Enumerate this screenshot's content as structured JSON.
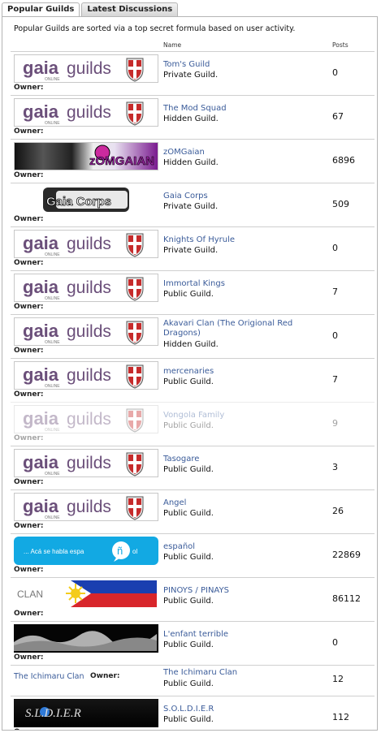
{
  "tabs": [
    {
      "label": "Popular Guilds",
      "active": true
    },
    {
      "label": "Latest Discussions",
      "active": false
    }
  ],
  "intro": "Popular Guilds are sorted via a top secret formula based on user activity.",
  "columns": {
    "name": "Name",
    "posts": "Posts"
  },
  "owner_label": "Owner:",
  "banner_text": {
    "gaia": "gaia",
    "online": "ONLINE",
    "guilds": "guilds",
    "zomg": "zOMGAIAN",
    "gaiacorps": "Gaia Corps",
    "espanol": "... Acá se habla espa",
    "espanol_n": "ñ",
    "espanol_tail": "ol",
    "clan": "CLAN",
    "soldier": "S.L.D.I.E.R"
  },
  "guilds": [
    {
      "name": "Tom's Guild",
      "type": "Private Guild.",
      "posts": "0",
      "banner": "gaia"
    },
    {
      "name": "The Mod Squad",
      "type": "Hidden Guild.",
      "posts": "67",
      "banner": "gaia"
    },
    {
      "name": "zOMGaian",
      "type": "Hidden Guild.",
      "posts": "6896",
      "banner": "zomg"
    },
    {
      "name": "Gaia Corps",
      "type": "Private Guild.",
      "posts": "509",
      "banner": "gaiacorps"
    },
    {
      "name": "Knights Of Hyrule",
      "type": "Private Guild.",
      "posts": "0",
      "banner": "gaia"
    },
    {
      "name": "Immortal Kings",
      "type": "Public Guild.",
      "posts": "7",
      "banner": "gaia"
    },
    {
      "name": "Akavari Clan (The Origional Red Dragons)",
      "type": "Hidden Guild.",
      "posts": "0",
      "banner": "gaia"
    },
    {
      "name": "mercenaries",
      "type": "Public Guild.",
      "posts": "7",
      "banner": "gaia"
    },
    {
      "name": "Vongola Family",
      "type": "Public Guild.",
      "posts": "9",
      "banner": "gaia",
      "faded": true
    },
    {
      "name": "Tasogare",
      "type": "Public Guild.",
      "posts": "3",
      "banner": "gaia"
    },
    {
      "name": "Angel",
      "type": "Public Guild.",
      "posts": "26",
      "banner": "gaia"
    },
    {
      "name": "español",
      "type": "Public Guild.",
      "posts": "22869",
      "banner": "espanol"
    },
    {
      "name": "PINOYS / PINAYS",
      "type": "Public Guild.",
      "posts": "86112",
      "banner": "pinoy"
    },
    {
      "name": "L'enfant terrible",
      "type": "Public Guild.",
      "posts": "0",
      "banner": "enfant"
    },
    {
      "name": "The Ichimaru Clan",
      "type": "Public Guild.",
      "posts": "12",
      "banner": "text",
      "banner_link": "The Ichimaru Clan"
    },
    {
      "name": "S.O.L.D.I.E.R",
      "type": "Public Guild.",
      "posts": "112",
      "banner": "soldier"
    }
  ]
}
